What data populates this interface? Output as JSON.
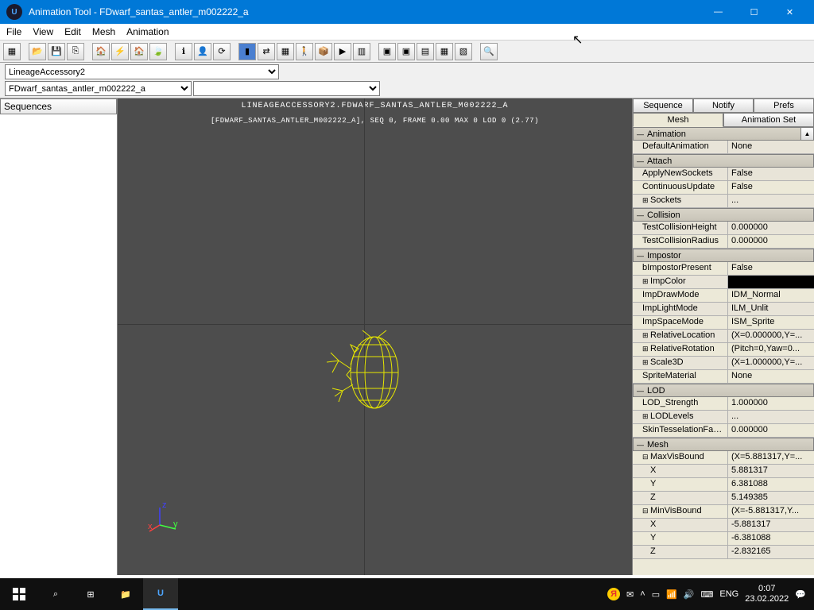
{
  "window": {
    "title": "Animation Tool - FDwarf_santas_antler_m002222_a"
  },
  "menu": {
    "file": "File",
    "view": "View",
    "edit": "Edit",
    "mesh": "Mesh",
    "animation": "Animation"
  },
  "combos": {
    "package": "LineageAccessory2",
    "asset": "FDwarf_santas_antler_m002222_a",
    "third": ""
  },
  "sequences_header": "Sequences",
  "viewport": {
    "header": "LINEAGEACCESSORY2.FDWARF_SANTAS_ANTLER_M002222_A",
    "status": "[FDWARF_SANTAS_ANTLER_M002222_A], SEQ 0,  FRAME  0.00 MAX 0  LOD 0 (2.77)"
  },
  "tabs": {
    "sequence": "Sequence",
    "notify": "Notify",
    "prefs": "Prefs",
    "mesh": "Mesh",
    "animset": "Animation Set"
  },
  "props": {
    "g_animation": "Animation",
    "defaultAnimation_l": "DefaultAnimation",
    "defaultAnimation_v": "None",
    "g_attach": "Attach",
    "applyNewSockets_l": "ApplyNewSockets",
    "applyNewSockets_v": "False",
    "continuousUpdate_l": "ContinuousUpdate",
    "continuousUpdate_v": "False",
    "sockets_l": "Sockets",
    "sockets_v": "...",
    "g_collision": "Collision",
    "testCollisionHeight_l": "TestCollisionHeight",
    "testCollisionHeight_v": "0.000000",
    "testCollisionRadius_l": "TestCollisionRadius",
    "testCollisionRadius_v": "0.000000",
    "g_impostor": "Impostor",
    "bImpostorPresent_l": "bImpostorPresent",
    "bImpostorPresent_v": "False",
    "impColor_l": "ImpColor",
    "impDrawMode_l": "ImpDrawMode",
    "impDrawMode_v": "IDM_Normal",
    "impLightMode_l": "ImpLightMode",
    "impLightMode_v": "ILM_Unlit",
    "impSpaceMode_l": "ImpSpaceMode",
    "impSpaceMode_v": "ISM_Sprite",
    "relativeLocation_l": "RelativeLocation",
    "relativeLocation_v": "(X=0.000000,Y=...",
    "relativeRotation_l": "RelativeRotation",
    "relativeRotation_v": "(Pitch=0,Yaw=0...",
    "scale3D_l": "Scale3D",
    "scale3D_v": "(X=1.000000,Y=...",
    "spriteMaterial_l": "SpriteMaterial",
    "spriteMaterial_v": "None",
    "g_lod": "LOD",
    "lodStrength_l": "LOD_Strength",
    "lodStrength_v": "1.000000",
    "lodLevels_l": "LODLevels",
    "lodLevels_v": "...",
    "skinTess_l": "SkinTesselationFac...",
    "skinTess_v": "0.000000",
    "g_mesh": "Mesh",
    "maxVisBound_l": "MaxVisBound",
    "maxVisBound_v": "(X=5.881317,Y=...",
    "max_x_l": "X",
    "max_x_v": "5.881317",
    "max_y_l": "Y",
    "max_y_v": "6.381088",
    "max_z_l": "Z",
    "max_z_v": "5.149385",
    "minVisBound_l": "MinVisBound",
    "minVisBound_v": "(X=-5.881317,Y...",
    "min_x_l": "X",
    "min_x_v": "-5.881317",
    "min_y_l": "Y",
    "min_y_v": "-6.381088",
    "min_z_l": "Z",
    "min_z_v": "-2.832165"
  },
  "taskbar": {
    "lang": "ENG",
    "time": "0:07",
    "date": "23.02.2022"
  }
}
